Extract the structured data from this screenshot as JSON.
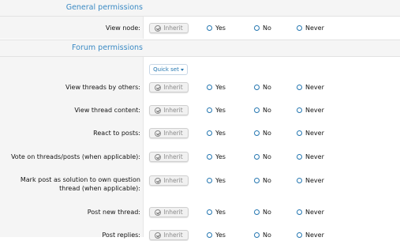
{
  "sections": {
    "general": {
      "title": "General permissions"
    },
    "forum": {
      "title": "Forum permissions",
      "quick_set": "Quick set"
    }
  },
  "options": {
    "inherit": "Inherit",
    "yes": "Yes",
    "no": "No",
    "never": "Never"
  },
  "rows": [
    {
      "label": "View node:"
    },
    {
      "label": "View threads by others:"
    },
    {
      "label": "View thread content:"
    },
    {
      "label": "React to posts:"
    },
    {
      "label": "Vote on threads/posts (when applicable):"
    },
    {
      "label": "Mark post as solution to own question thread (when applicable):"
    },
    {
      "label": "Post new thread:"
    },
    {
      "label": "Post replies:"
    }
  ],
  "colors": {
    "accent": "#2577b1",
    "header_text": "#3b8ac4",
    "panel_bg": "#f5f5f5"
  }
}
